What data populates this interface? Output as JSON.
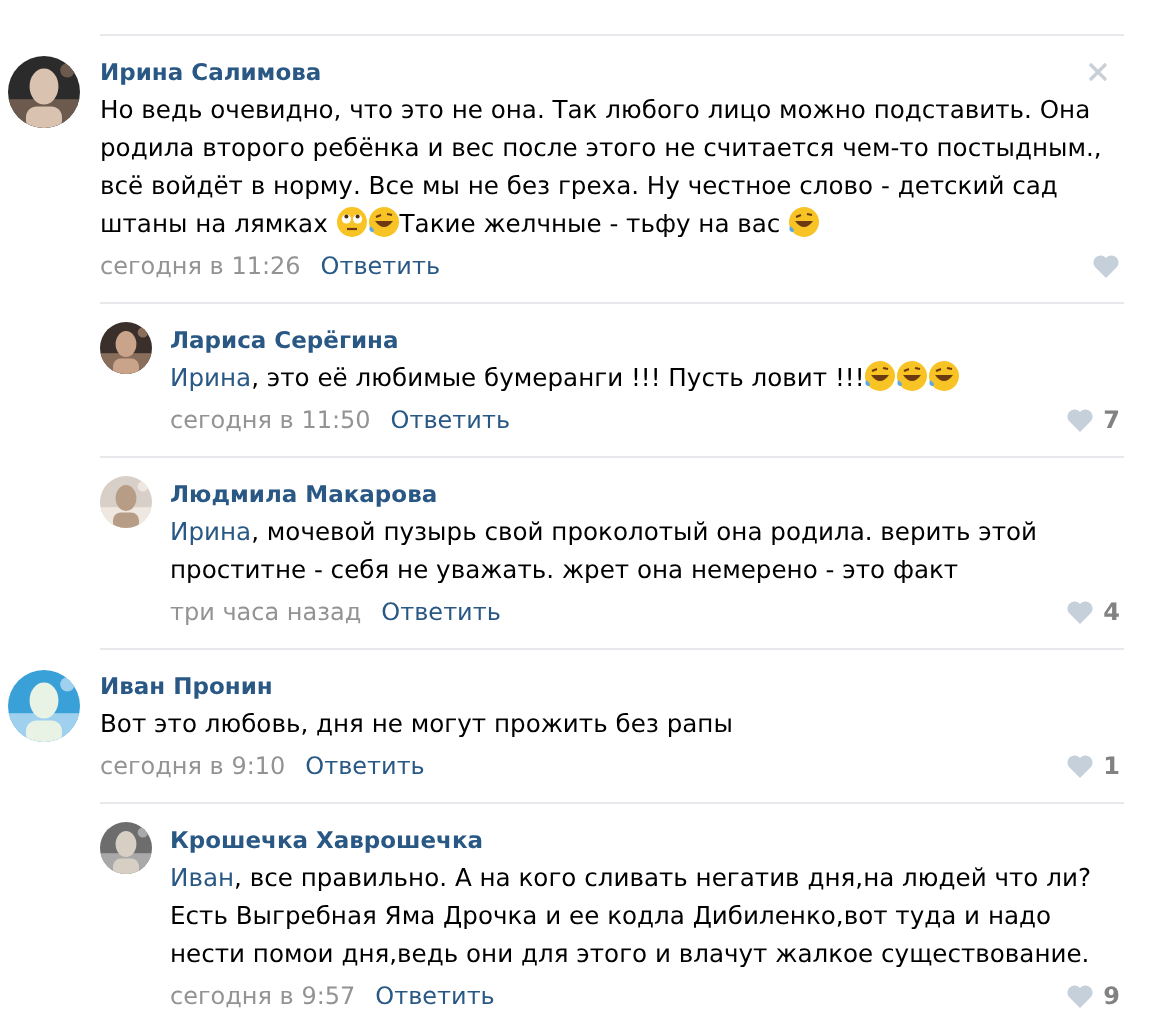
{
  "comments": [
    {
      "author": "Ирина Салимова",
      "closable": true,
      "body": [
        {
          "kind": "text",
          "text": "Но ведь очевидно, что это не она. Так любого лицо можно подставить. Она родила второго ребёнка и вес после этого не считается чем-то постыдным., всё войдёт в норму. Все мы не без греха. Ну честное слово - детский сад штаны на лямках "
        },
        {
          "kind": "eyeroll"
        },
        {
          "kind": "laugh"
        },
        {
          "kind": "text",
          "text": "Такие желчные - тьфу на вас "
        },
        {
          "kind": "laugh"
        }
      ],
      "time": "сегодня в 11:26",
      "reply": "Ответить",
      "children": [
        {
          "author": "Лариса Серёгина",
          "closable": false,
          "body": [
            {
              "kind": "mention",
              "text": "Ирина"
            },
            {
              "kind": "text",
              "text": ", это её любимые бумеранги !!! Пусть ловит !!!"
            },
            {
              "kind": "laugh"
            },
            {
              "kind": "laugh"
            },
            {
              "kind": "laugh"
            }
          ],
          "time": "сегодня в 11:50",
          "reply": "Ответить",
          "likes": "7"
        },
        {
          "author": "Людмила Макарова",
          "closable": false,
          "body": [
            {
              "kind": "mention",
              "text": "Ирина"
            },
            {
              "kind": "text",
              "text": ", мочевой пузырь свой проколотый она родила. верить этой проститне - себя не уважать. жрет она немерено - это факт"
            }
          ],
          "time": "три часа назад",
          "reply": "Ответить",
          "likes": "4"
        }
      ]
    },
    {
      "author": "Иван Пронин",
      "closable": false,
      "body": [
        {
          "kind": "text",
          "text": "Вот это любовь, дня не могут прожить без рапы"
        }
      ],
      "time": "сегодня в 9:10",
      "reply": "Ответить",
      "likes": "1",
      "children": [
        {
          "author": "Крошечка Хаврошечка",
          "closable": false,
          "body": [
            {
              "kind": "mention",
              "text": "Иван"
            },
            {
              "kind": "text",
              "text": ", все правильно. А на кого сливать негатив дня,на людей что ли? Есть Выгребная Яма Дрочка и ее кодла Дибиленко,вот туда и надо нести помои дня,ведь они для этого и влачут жалкое существование."
            }
          ],
          "time": "сегодня в 9:57",
          "reply": "Ответить",
          "likes": "9"
        }
      ]
    }
  ]
}
